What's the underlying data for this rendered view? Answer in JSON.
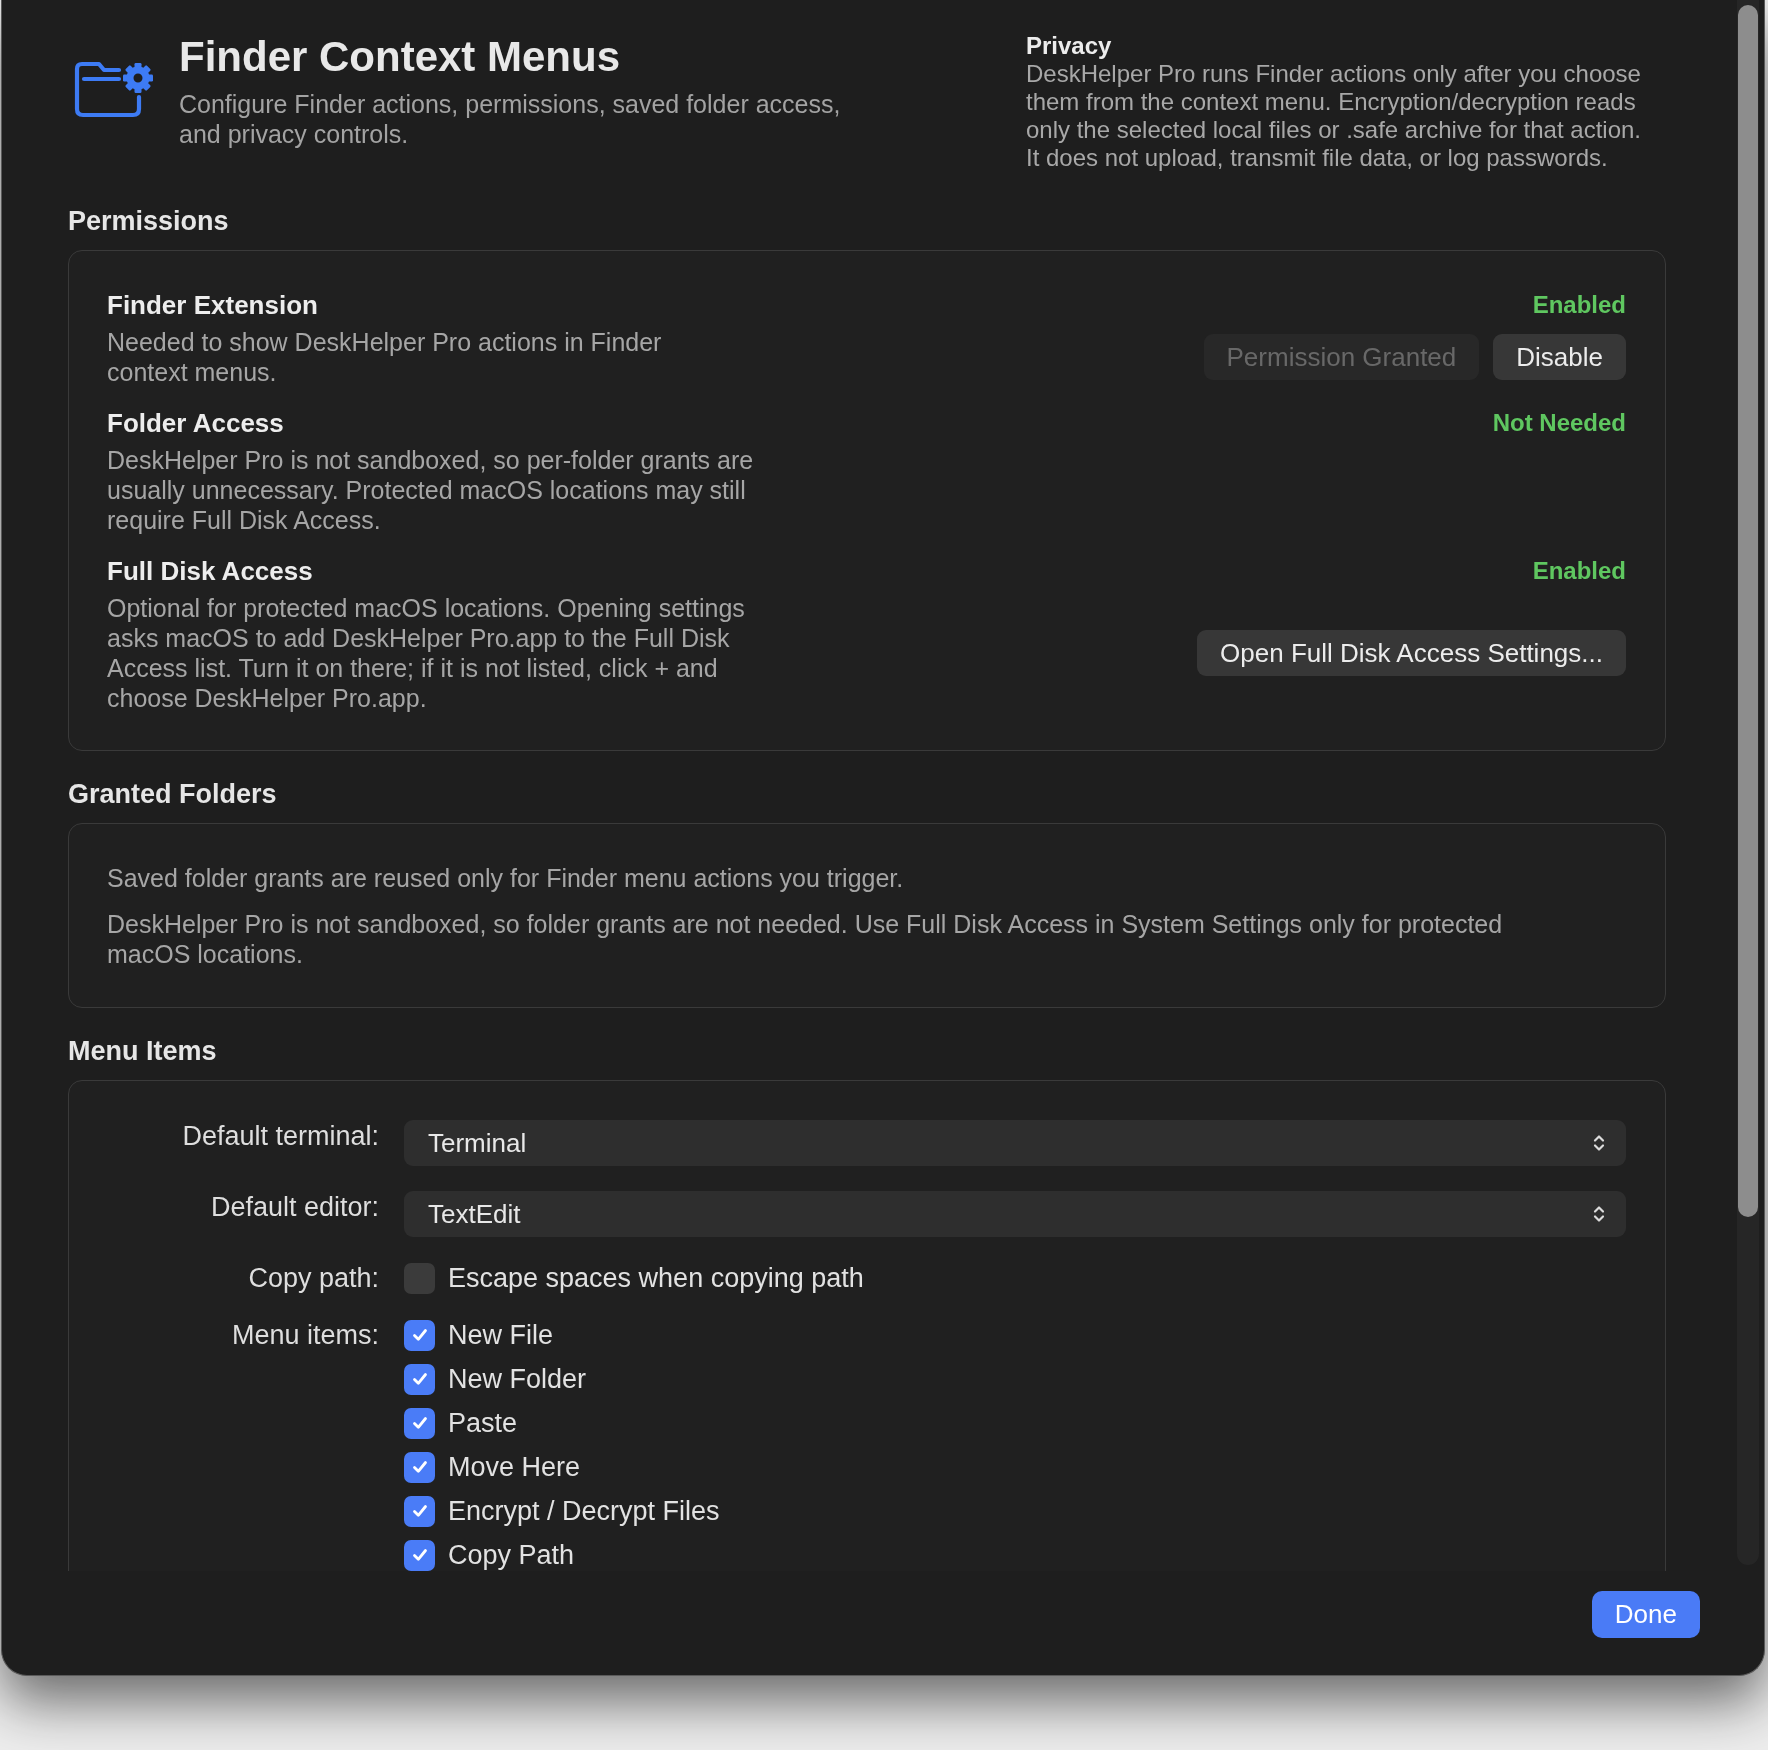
{
  "header": {
    "title": "Finder Context Menus",
    "subtitle": "Configure Finder actions, permissions, saved folder access, and privacy controls."
  },
  "privacy": {
    "title": "Privacy",
    "text": "DeskHelper Pro runs Finder actions only after you choose them from the context menu. Encryption/decryption reads only the selected local files or .safe archive for that action. It does not upload, transmit file data, or log passwords."
  },
  "permissions": {
    "title": "Permissions",
    "items": [
      {
        "name": "Finder Extension",
        "description": "Needed to show DeskHelper Pro actions in Finder context menus.",
        "status": "Enabled",
        "buttons": [
          {
            "label": "Permission Granted",
            "disabled": true
          },
          {
            "label": "Disable",
            "disabled": false
          }
        ]
      },
      {
        "name": "Folder Access",
        "description": "DeskHelper Pro is not sandboxed, so per-folder grants are usually unnecessary. Protected macOS locations may still require Full Disk Access.",
        "status": "Not Needed"
      },
      {
        "name": "Full Disk Access",
        "description": "Optional for protected macOS locations. Opening settings asks macOS to add DeskHelper Pro.app to the Full Disk Access list. Turn it on there; if it is not listed, click + and choose DeskHelper Pro.app.",
        "status": "Enabled",
        "buttons": [
          {
            "label": "Open Full Disk Access Settings...",
            "disabled": false
          }
        ]
      }
    ]
  },
  "granted_folders": {
    "title": "Granted Folders",
    "paragraphs": [
      "Saved folder grants are reused only for Finder menu actions you trigger.",
      "DeskHelper Pro is not sandboxed, so folder grants are not needed. Use Full Disk Access in System Settings only for protected macOS locations."
    ]
  },
  "menu_items": {
    "title": "Menu Items",
    "rows": [
      {
        "kind": "popup",
        "label": "Default terminal:",
        "value": "Terminal"
      },
      {
        "kind": "popup",
        "label": "Default editor:",
        "value": "TextEdit"
      },
      {
        "kind": "checkboxes",
        "label": "Copy path:",
        "options": [
          {
            "label": "Escape spaces when copying path",
            "checked": false
          }
        ]
      },
      {
        "kind": "checkboxes",
        "label": "Menu items:",
        "options": [
          {
            "label": "New File",
            "checked": true
          },
          {
            "label": "New Folder",
            "checked": true
          },
          {
            "label": "Paste",
            "checked": true
          },
          {
            "label": "Move Here",
            "checked": true
          },
          {
            "label": "Encrypt / Decrypt Files",
            "checked": true
          },
          {
            "label": "Copy Path",
            "checked": true
          }
        ]
      }
    ]
  },
  "footer": {
    "done_button": "Done"
  }
}
